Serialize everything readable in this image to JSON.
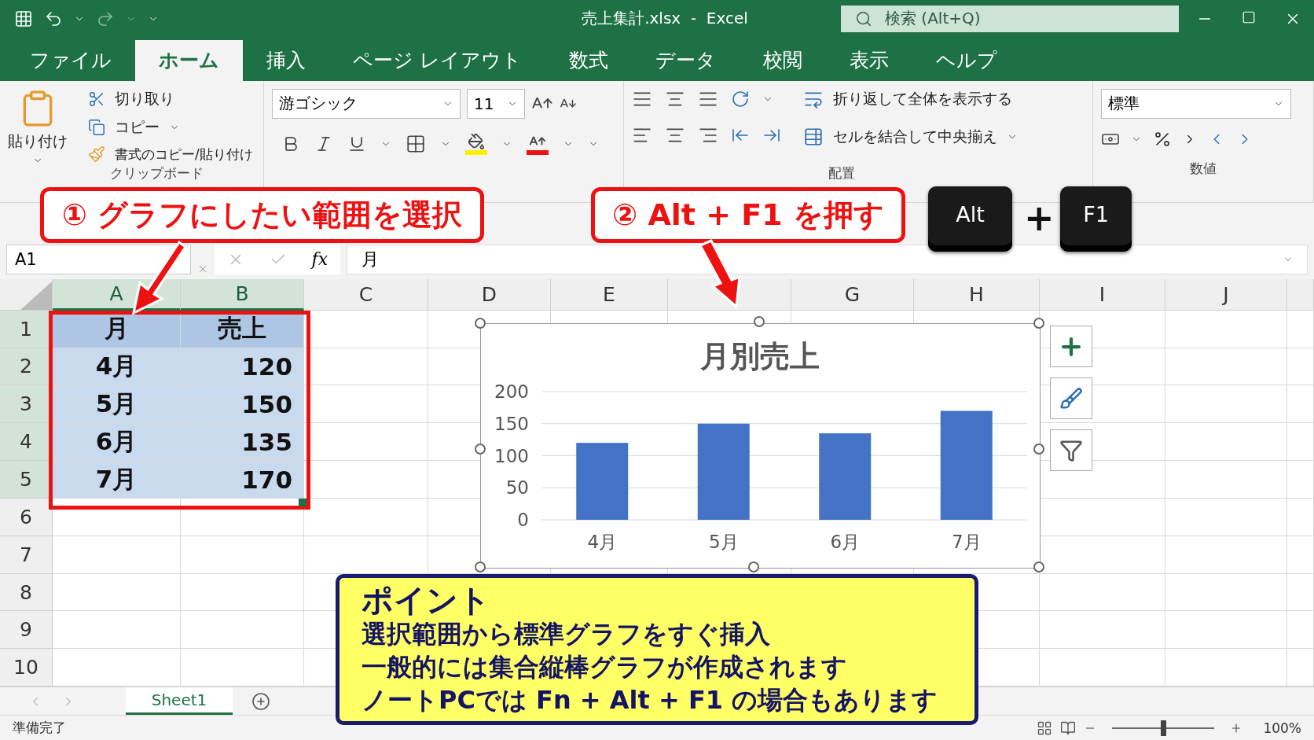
{
  "title_bar": {
    "title": "売上集計.xlsx  -  Excel",
    "search": {
      "placeholder": "検索 (Alt+Q)"
    }
  },
  "tabs": [
    {
      "label": "ファイル",
      "selected": false
    },
    {
      "label": "ホーム",
      "selected": true
    },
    {
      "label": "挿入",
      "selected": false
    },
    {
      "label": "ページ レイアウト",
      "selected": false
    },
    {
      "label": "数式",
      "selected": false
    },
    {
      "label": "データ",
      "selected": false
    },
    {
      "label": "校閲",
      "selected": false
    },
    {
      "label": "表示",
      "selected": false
    },
    {
      "label": "ヘルプ",
      "selected": false
    }
  ],
  "ribbon": {
    "clipboard": {
      "paste": "貼り付け",
      "cut": "切り取り",
      "copy": "コピー",
      "format_painter": "書式のコピー/貼り付け",
      "label": "クリップボード"
    },
    "font": {
      "font_name": "游ゴシック",
      "font_size": "11"
    },
    "alignment": {
      "wrap_text": "折り返して全体を表示する",
      "merge_center": "セルを結合して中央揃え",
      "label": "配置"
    },
    "number": {
      "format": "標準",
      "label": "数値"
    }
  },
  "formula_bar": {
    "name_box": "A1",
    "function_label": "fx",
    "content": "月"
  },
  "sheet": {
    "columns": [
      {
        "label": "A",
        "selected": true
      },
      {
        "label": "B",
        "selected": true
      },
      {
        "label": "C",
        "selected": false
      },
      {
        "label": "D",
        "selected": false
      },
      {
        "label": "E",
        "selected": false
      },
      {
        "selected": false
      },
      {
        "label": "G",
        "selected": false
      },
      {
        "label": "H",
        "selected": false
      },
      {
        "label": "I",
        "selected": false
      },
      {
        "label": "J",
        "selected": false
      }
    ],
    "rows": [
      {
        "number": "1",
        "header": true,
        "cells": [
          "月",
          "売上"
        ]
      },
      {
        "number": "2",
        "header": false,
        "cells": [
          "4月",
          "120"
        ]
      },
      {
        "number": "3",
        "header": false,
        "cells": [
          "5月",
          "150"
        ]
      },
      {
        "number": "4",
        "header": false,
        "cells": [
          "6月",
          "135"
        ]
      },
      {
        "number": "5",
        "header": false,
        "cells": [
          "7月",
          "170"
        ]
      },
      {
        "number": "6"
      },
      {
        "number": "7"
      },
      {
        "number": "8"
      },
      {
        "number": "9"
      },
      {
        "number": "10"
      }
    ]
  },
  "chart": {
    "chart_data": {
      "type": "bar",
      "title": "月別売上",
      "categories": [
        "4月",
        "5月",
        "6月",
        "7月"
      ],
      "values": [
        120,
        150,
        135,
        170
      ],
      "grid": true,
      "ylim": [
        0,
        200
      ],
      "yticks": [
        0,
        50,
        100,
        150,
        200
      ]
    }
  },
  "callouts": [
    {
      "text": "① グラフにしたい範囲を選択"
    },
    {
      "text": "② Alt + F1 を押す"
    }
  ],
  "keys": [
    {
      "kind": "key",
      "label": "Alt"
    },
    {
      "kind": "plus",
      "label": "+"
    },
    {
      "kind": "key",
      "label": "F1"
    }
  ],
  "point": {
    "title": "ポイント",
    "lines": [
      "選択範囲から標準グラフをすぐ挿入",
      "一般的には集合縦棒グラフが作成されます",
      "ノートPCでは Fn + Alt + F1 の場合もあります"
    ]
  },
  "sheet_tabs": [
    {
      "label": "Sheet1",
      "selected": true
    }
  ],
  "status_bar": {
    "status": "準備完了",
    "zoom": {
      "level": 0.5,
      "reading": "100%"
    }
  }
}
